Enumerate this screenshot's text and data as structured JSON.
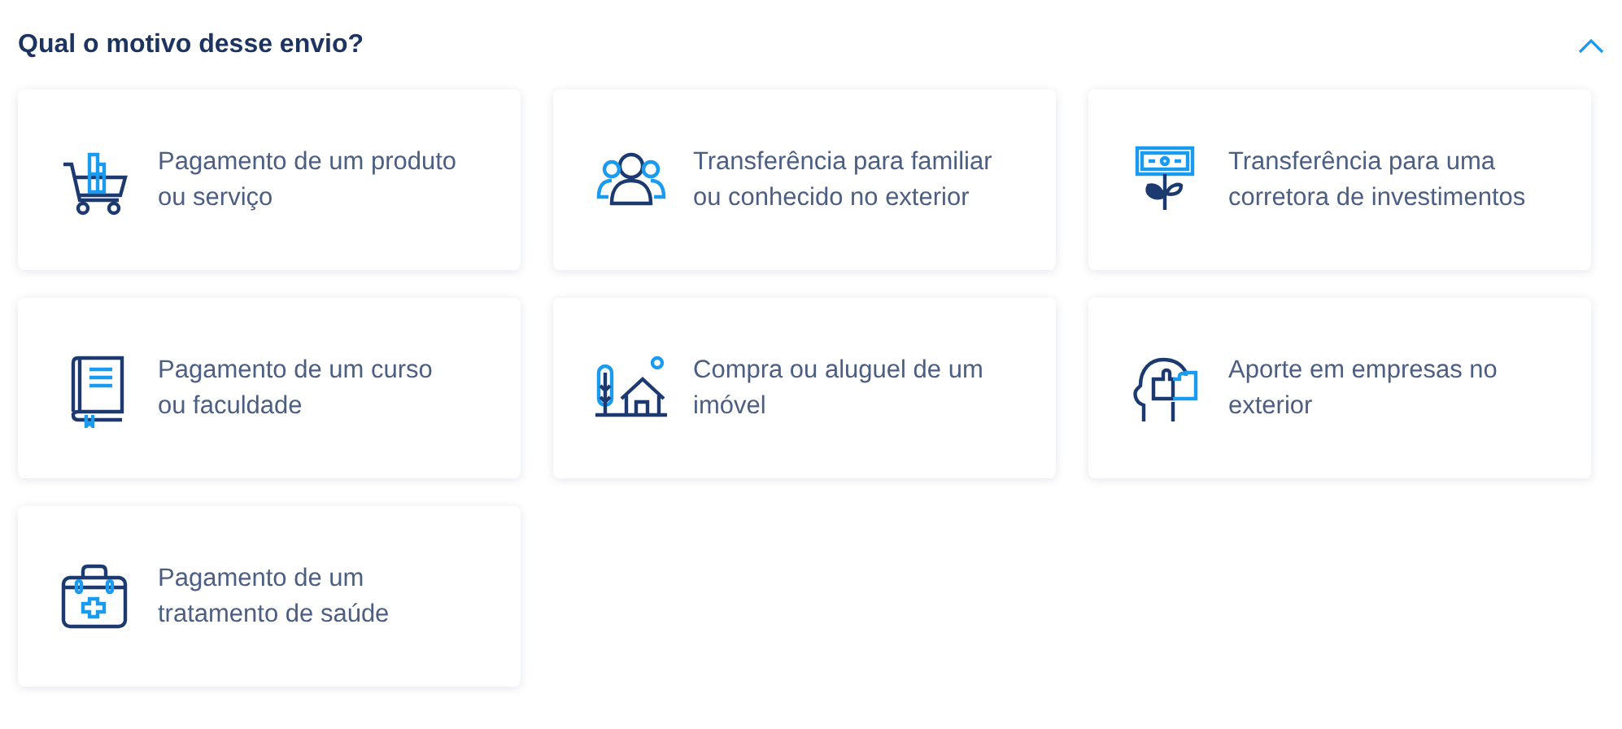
{
  "section": {
    "title": "Qual o motivo desse envio?",
    "expanded": true
  },
  "options": [
    {
      "kind": "cart",
      "lines": [
        "Pagamento de um produto",
        "ou serviço"
      ]
    },
    {
      "kind": "people",
      "lines": [
        "Transferência para familiar",
        "ou conhecido no exterior"
      ]
    },
    {
      "kind": "money-plant",
      "lines": [
        "Transferência para uma",
        "corretora de investimentos"
      ]
    },
    {
      "kind": "book",
      "lines": [
        "Pagamento de um curso",
        "ou faculdade"
      ]
    },
    {
      "kind": "house",
      "lines": [
        "Compra ou aluguel de um",
        "imóvel"
      ]
    },
    {
      "kind": "head-puzzle",
      "lines": [
        "Aporte em empresas no",
        "exterior"
      ]
    },
    {
      "kind": "medical-kit",
      "lines": [
        "Pagamento de um",
        "tratamento de saúde"
      ]
    }
  ]
}
